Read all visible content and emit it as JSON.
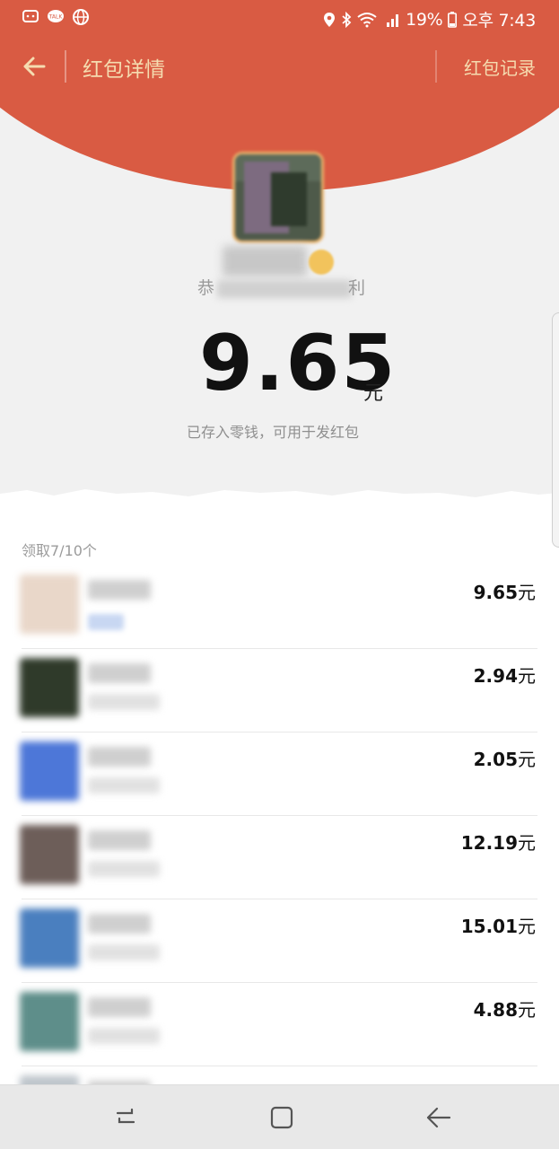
{
  "status_bar": {
    "battery": "19%",
    "time": "오후 7:43"
  },
  "header": {
    "title": "红包详情",
    "right_link": "红包记录"
  },
  "summary": {
    "greeting_start": "恭",
    "greeting_end": "利",
    "amount": "9.65",
    "unit": "元",
    "note": "已存入零钱，可用于发红包"
  },
  "list": {
    "count_label": "领取7/10个",
    "rows": [
      {
        "amount": "9.65",
        "unit": "元",
        "avatar_color": "#e9d7c9"
      },
      {
        "amount": "2.94",
        "unit": "元",
        "avatar_color": "#2f3a2a"
      },
      {
        "amount": "2.05",
        "unit": "元",
        "avatar_color": "#4d77d8"
      },
      {
        "amount": "12.19",
        "unit": "元",
        "avatar_color": "#6d5e59"
      },
      {
        "amount": "15.01",
        "unit": "元",
        "avatar_color": "#4a7fbf"
      },
      {
        "amount": "4.88",
        "unit": "元",
        "avatar_color": "#5e8e8a"
      }
    ]
  },
  "colors": {
    "header_red": "#d95b43",
    "header_text": "#f5dcb0"
  },
  "icons": [
    "app-icon",
    "talk-icon",
    "globe-icon",
    "location-icon",
    "bluetooth-icon",
    "wifi-icon",
    "signal-icon",
    "battery-icon",
    "back-arrow-icon",
    "recents-icon",
    "home-icon",
    "nav-back-icon"
  ]
}
